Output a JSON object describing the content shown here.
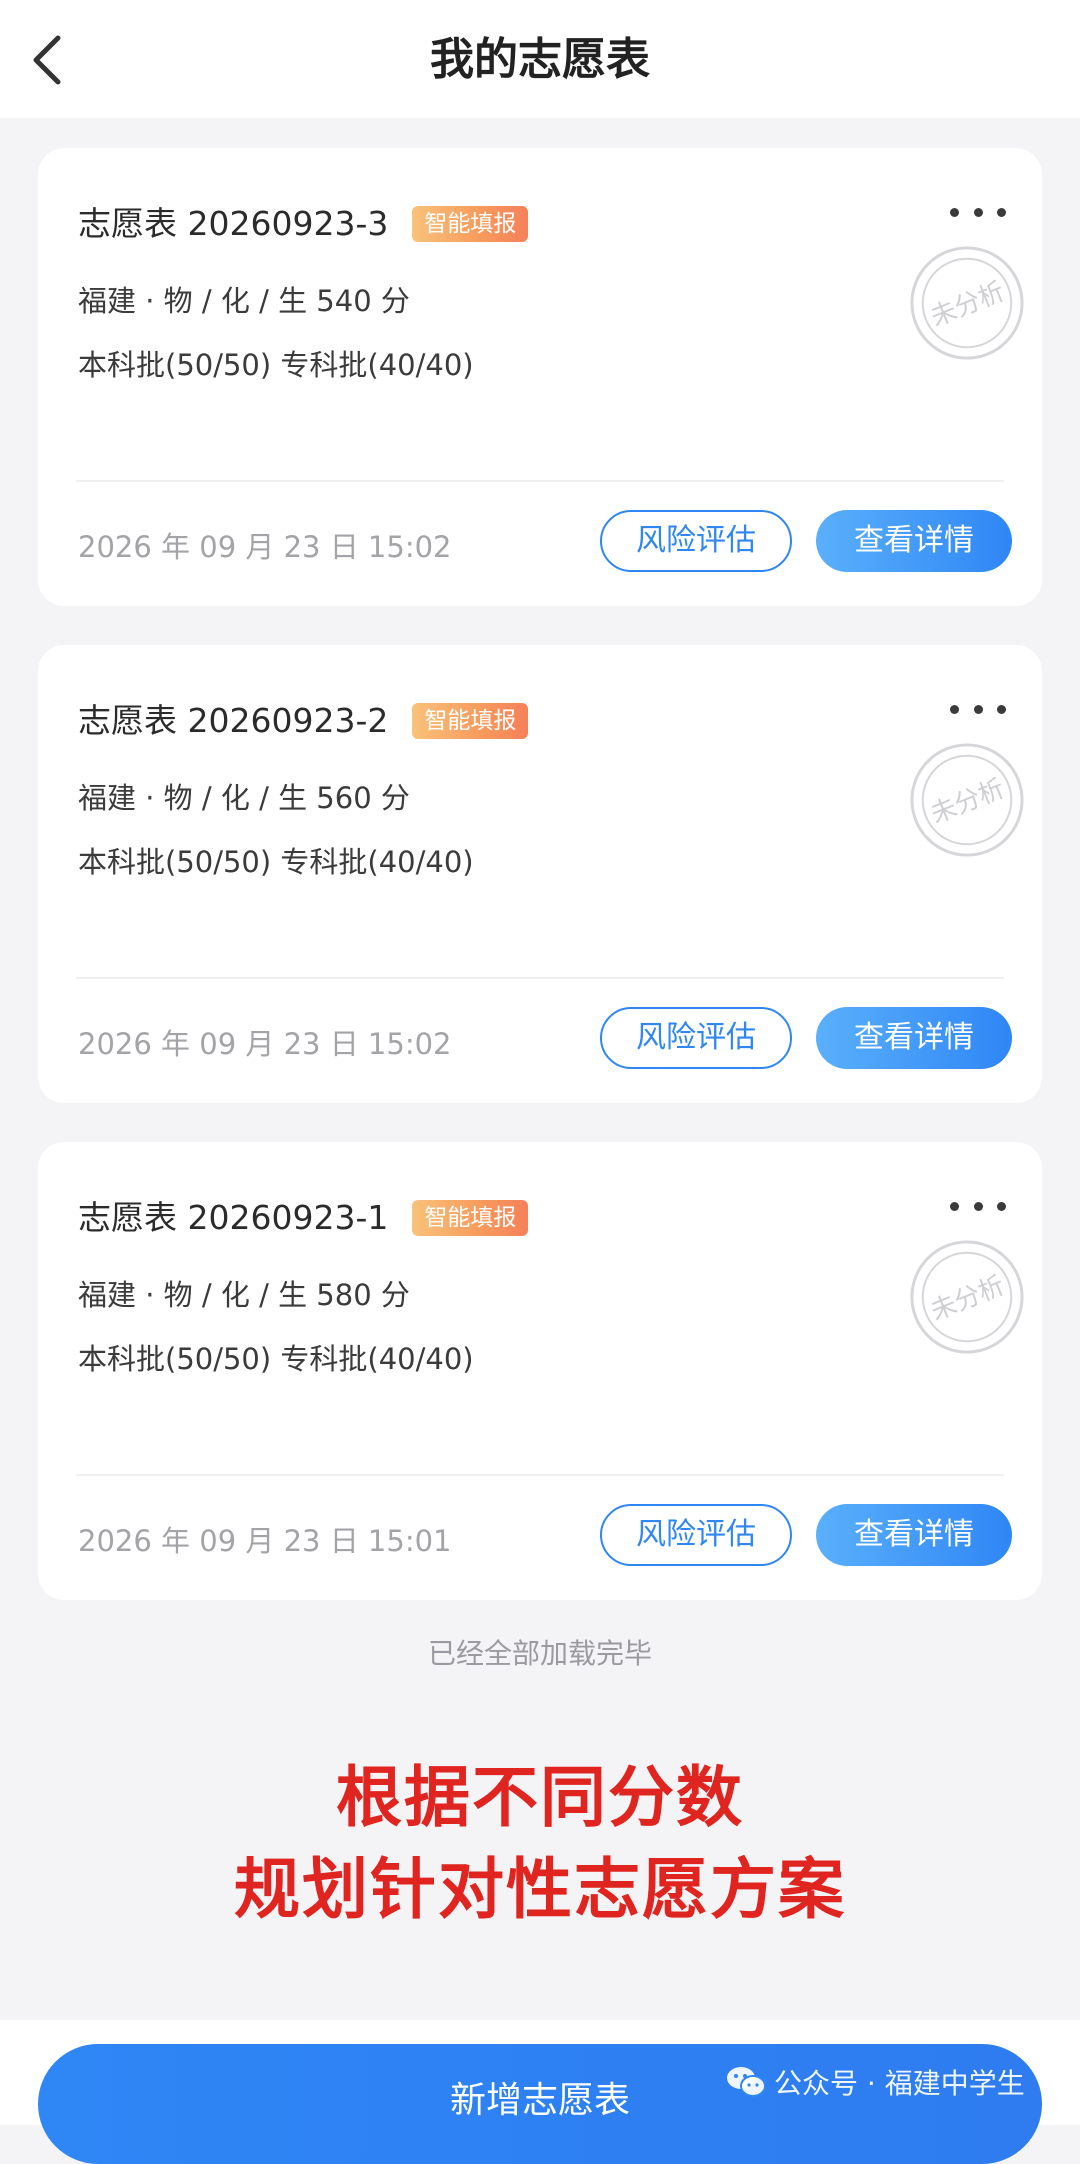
{
  "header": {
    "title": "我的志愿表"
  },
  "cards": [
    {
      "name": "志愿表 20260923-3",
      "tag": "智能填报",
      "profile": "福建 · 物 / 化 / 生 540 分",
      "batches": "本科批(50/50)   专科批(40/40)",
      "stamp": "未分析",
      "date": "2026 年 09 月 23 日 15:02",
      "risk_label": "风险评估",
      "detail_label": "查看详情"
    },
    {
      "name": "志愿表 20260923-2",
      "tag": "智能填报",
      "profile": "福建 · 物 / 化 / 生 560 分",
      "batches": "本科批(50/50)   专科批(40/40)",
      "stamp": "未分析",
      "date": "2026 年 09 月 23 日 15:02",
      "risk_label": "风险评估",
      "detail_label": "查看详情"
    },
    {
      "name": "志愿表 20260923-1",
      "tag": "智能填报",
      "profile": "福建 · 物 / 化 / 生 580 分",
      "batches": "本科批(50/50)   专科批(40/40)",
      "stamp": "未分析",
      "date": "2026 年 09 月 23 日 15:01",
      "risk_label": "风险评估",
      "detail_label": "查看详情"
    }
  ],
  "list_end_text": "已经全部加载完毕",
  "promo": {
    "line1": "根据不同分数",
    "line2": "规划针对性志愿方案"
  },
  "footer": {
    "add_label": "新增志愿表",
    "watermark": "公众号 · 福建中学生"
  },
  "colors": {
    "accent": "#2f86f5",
    "promo": "#e0241f",
    "tag": "#f79a5c"
  }
}
